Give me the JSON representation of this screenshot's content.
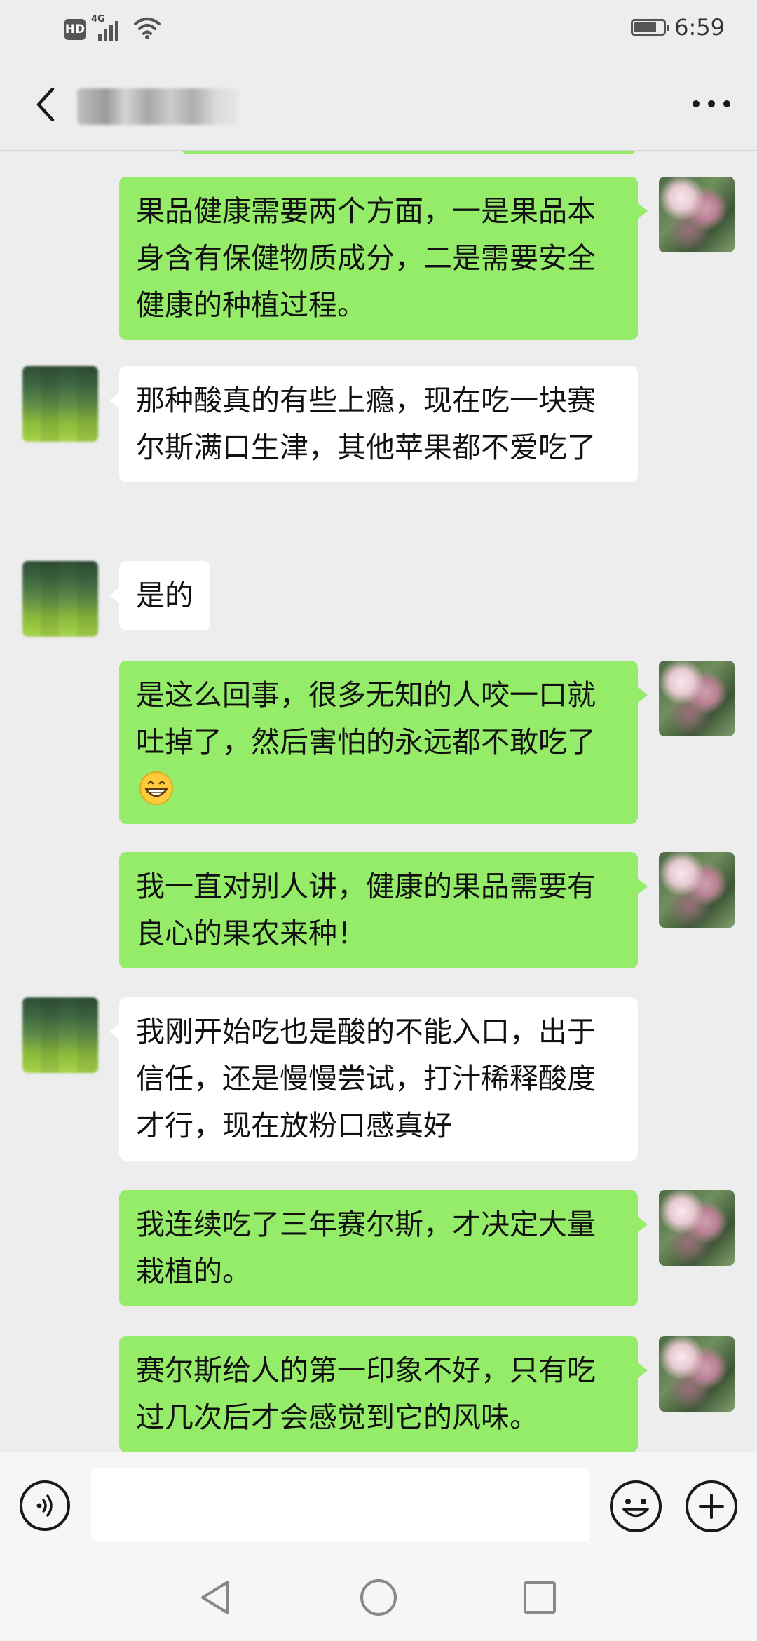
{
  "status_bar": {
    "hd_badge": "HD",
    "network": "4G",
    "time": "6:59",
    "icons": [
      "hd-icon",
      "signal-4g-icon",
      "wifi-icon",
      "battery-icon"
    ]
  },
  "header": {
    "back_icon": "chevron-left-icon",
    "more_icon": "more-horizontal-icon",
    "title_obscured": true
  },
  "messages": [
    {
      "sender": "me",
      "text": "果品健康需要两个方面，一是果品本身含有保健物质成分，二是需要安全健康的种植过程。"
    },
    {
      "sender": "peer",
      "text": "那种酸真的有些上瘾，现在吃一块赛尔斯满口生津，其他苹果都不爱吃了"
    },
    {
      "sender": "peer",
      "text": "是的"
    },
    {
      "sender": "me",
      "text": "是这么回事，很多无知的人咬一口就吐掉了，然后害怕的永远都不敢吃了",
      "emoji": "grinning-face-emoji"
    },
    {
      "sender": "me",
      "text": "我一直对别人讲，健康的果品需要有良心的果农来种！"
    },
    {
      "sender": "peer",
      "text": "我刚开始吃也是酸的不能入口，出于信任，还是慢慢尝试，打汁稀释酸度才行，现在放粉口感真好"
    },
    {
      "sender": "me",
      "text": "我连续吃了三年赛尔斯，才决定大量栽植的。"
    },
    {
      "sender": "me",
      "text": "赛尔斯给人的第一印象不好，只有吃过几次后才会感觉到它的风味。"
    }
  ],
  "input_bar": {
    "placeholder": "",
    "voice_icon": "voice-icon",
    "emoji_icon": "emoji-icon",
    "plus_icon": "plus-icon"
  },
  "system_nav": {
    "icons": [
      "back-triangle-icon",
      "home-circle-icon",
      "recents-square-icon"
    ]
  },
  "colors": {
    "background": "#ededed",
    "outgoing_bubble": "#95ec69",
    "incoming_bubble": "#ffffff",
    "text": "#111111",
    "icon": "#191919"
  }
}
